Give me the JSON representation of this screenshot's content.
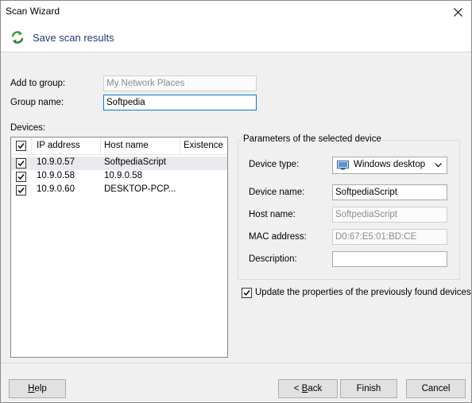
{
  "window": {
    "title": "Scan Wizard"
  },
  "header": {
    "title": "Save scan results",
    "icon": "refresh-arrows-icon"
  },
  "form": {
    "add_to_group_label": "Add to group:",
    "add_to_group_value": "My Network Places",
    "group_name_label": "Group name:",
    "group_name_value": "Softpedia",
    "devices_label": "Devices:"
  },
  "devices": {
    "columns": [
      "IP address",
      "Host name",
      "Existence"
    ],
    "all_checked": true,
    "rows": [
      {
        "checked": true,
        "ip": "10.9.0.57",
        "host": "SoftpediaScript",
        "existence": "",
        "selected": true
      },
      {
        "checked": true,
        "ip": "10.9.0.58",
        "host": "10.9.0.58",
        "existence": "",
        "selected": false
      },
      {
        "checked": true,
        "ip": "10.9.0.60",
        "host": "DESKTOP-PCP...",
        "existence": "",
        "selected": false
      }
    ]
  },
  "params": {
    "group_title": "Parameters of the selected device",
    "device_type_label": "Device type:",
    "device_type_value": "Windows desktop",
    "device_type_icon": "monitor-icon",
    "device_name_label": "Device name:",
    "device_name_value": "SoftpediaScript",
    "host_name_label": "Host name:",
    "host_name_value": "SoftpediaScript",
    "mac_label": "MAC address:",
    "mac_value": "D0:67:E5:01:BD:CE",
    "description_label": "Description:",
    "description_value": ""
  },
  "update_props": {
    "checked": true,
    "label": "Update the properties of the previously found devices"
  },
  "buttons": {
    "help": {
      "mnemonic": "H",
      "rest": "elp"
    },
    "back": {
      "pre": "< ",
      "mnemonic": "B",
      "rest": "ack"
    },
    "finish": "Finish",
    "cancel": "Cancel"
  },
  "colors": {
    "accent": "#0078d7",
    "header_text": "#1f3a7a",
    "icon_green": "#3c9a3c"
  }
}
